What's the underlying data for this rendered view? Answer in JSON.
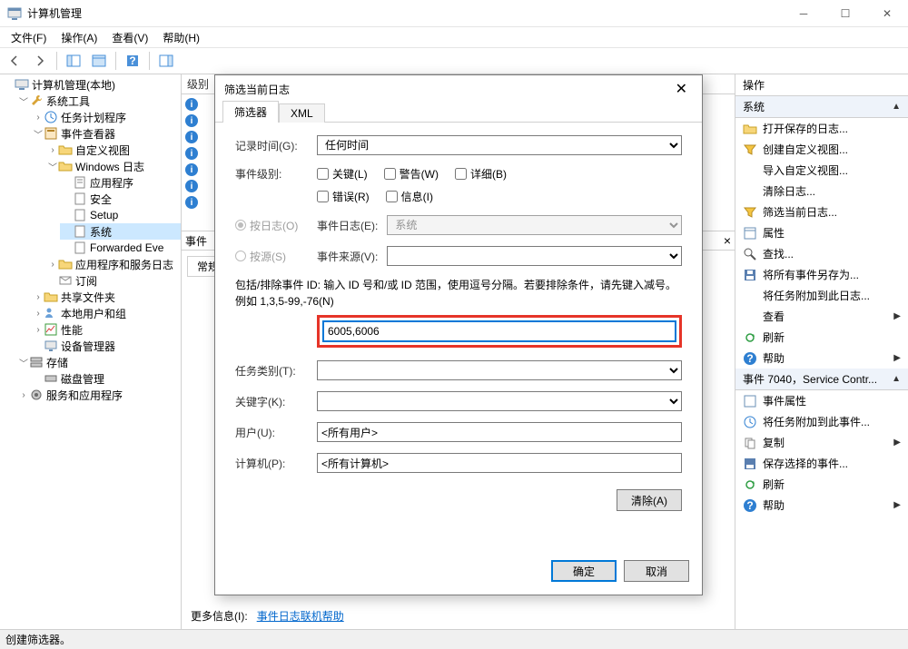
{
  "window": {
    "title": "计算机管理"
  },
  "menubar": {
    "file": "文件(F)",
    "action": "操作(A)",
    "view": "查看(V)",
    "help": "帮助(H)"
  },
  "statusbar": {
    "text": "创建筛选器。"
  },
  "tree": {
    "root": "计算机管理(本地)",
    "sys_tools": "系统工具",
    "task_scheduler": "任务计划程序",
    "event_viewer": "事件查看器",
    "custom_views": "自定义视图",
    "windows_logs": "Windows 日志",
    "app_log": "应用程序",
    "security_log": "安全",
    "setup_log": "Setup",
    "system_log": "系统",
    "forwarded": "Forwarded Eve",
    "apps_services_logs": "应用程序和服务日志",
    "subscriptions": "订阅",
    "shared_folders": "共享文件夹",
    "local_users": "本地用户和组",
    "performance": "性能",
    "device_manager": "设备管理器",
    "storage": "存储",
    "disk_mgmt": "磁盘管理",
    "services_apps": "服务和应用程序"
  },
  "center": {
    "list_header_level": "级别",
    "detail_header": "事件",
    "tab_general": "常规",
    "more_info_label": "更多信息(I):",
    "more_info_link": "事件日志联机帮助"
  },
  "actions": {
    "pane_title": "操作",
    "group_system": "系统",
    "open_saved": "打开保存的日志...",
    "create_view": "创建自定义视图...",
    "import_view": "导入自定义视图...",
    "clear_log": "清除日志...",
    "filter_current": "筛选当前日志...",
    "properties": "属性",
    "find": "查找...",
    "save_all": "将所有事件另存为...",
    "attach_task": "将任务附加到此日志...",
    "view": "查看",
    "refresh": "刷新",
    "help": "帮助",
    "group_event": "事件 7040，Service Contr...",
    "event_props": "事件属性",
    "attach_task2": "将任务附加到此事件...",
    "copy": "复制",
    "save_selected": "保存选择的事件...",
    "refresh2": "刷新",
    "help2": "帮助"
  },
  "dialog": {
    "title": "筛选当前日志",
    "tab_filter": "筛选器",
    "tab_xml": "XML",
    "logged_label": "记录时间(G):",
    "logged_value": "任何时间",
    "level_label": "事件级别:",
    "level_critical": "关键(L)",
    "level_warning": "警告(W)",
    "level_verbose": "详细(B)",
    "level_error": "错误(R)",
    "level_info": "信息(I)",
    "bylog_label": "按日志(O)",
    "eventlog_label": "事件日志(E):",
    "eventlog_value": "系统",
    "bysource_label": "按源(S)",
    "eventsource_label": "事件来源(V):",
    "id_desc": "包括/排除事件 ID: 输入 ID 号和/或 ID 范围，使用逗号分隔。若要排除条件，请先键入减号。例如 1,3,5-99,-76(N)",
    "id_value": "6005,6006",
    "task_label": "任务类别(T):",
    "keywords_label": "关键字(K):",
    "user_label": "用户(U):",
    "user_value": "<所有用户>",
    "computer_label": "计算机(P):",
    "computer_value": "<所有计算机>",
    "clear_btn": "清除(A)",
    "ok_btn": "确定",
    "cancel_btn": "取消"
  }
}
